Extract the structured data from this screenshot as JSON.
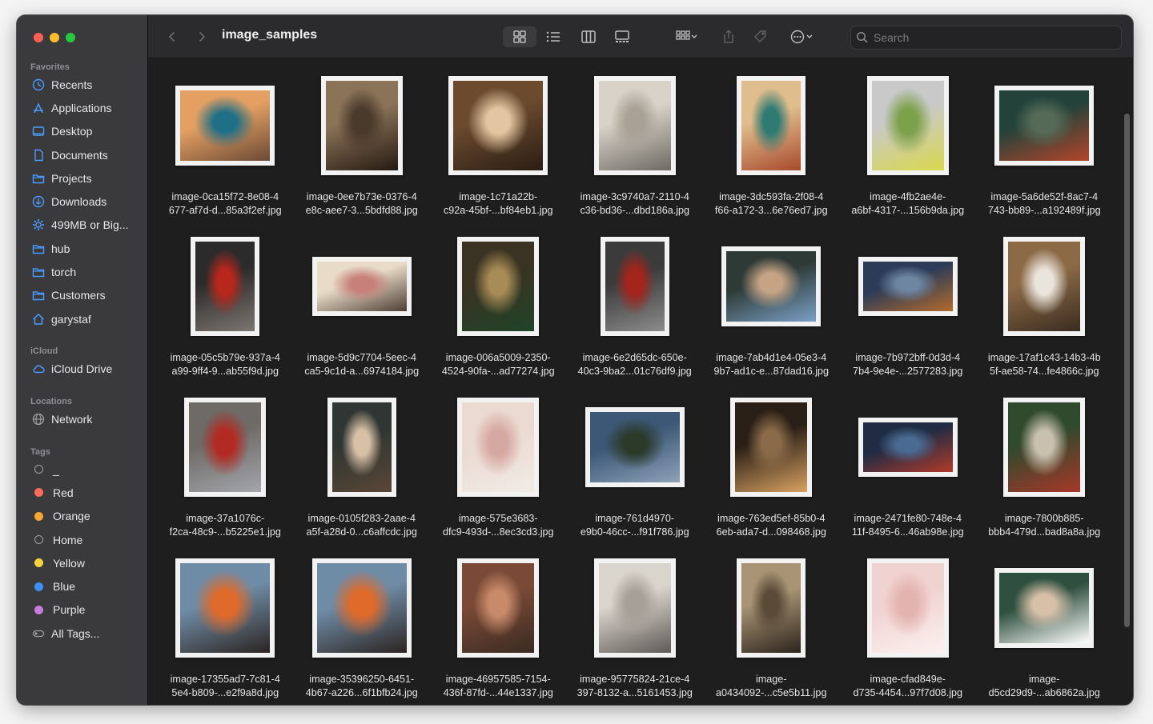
{
  "window": {
    "title": "image_samples"
  },
  "sidebar": {
    "sections": [
      {
        "heading": "Favorites",
        "items": [
          {
            "label": "Recents",
            "icon": "clock-icon"
          },
          {
            "label": "Applications",
            "icon": "applications-icon"
          },
          {
            "label": "Desktop",
            "icon": "desktop-icon"
          },
          {
            "label": "Documents",
            "icon": "document-icon"
          },
          {
            "label": "Projects",
            "icon": "folder-icon"
          },
          {
            "label": "Downloads",
            "icon": "download-icon"
          },
          {
            "label": "499MB or Big...",
            "icon": "smart-folder-icon"
          },
          {
            "label": "hub",
            "icon": "folder-icon"
          },
          {
            "label": "torch",
            "icon": "folder-icon"
          },
          {
            "label": "Customers",
            "icon": "folder-icon"
          },
          {
            "label": "garystaf",
            "icon": "home-icon"
          }
        ]
      },
      {
        "heading": "iCloud",
        "items": [
          {
            "label": "iCloud Drive",
            "icon": "cloud-icon"
          }
        ]
      },
      {
        "heading": "Locations",
        "items": [
          {
            "label": "Network",
            "icon": "network-icon"
          }
        ]
      },
      {
        "heading": "Tags",
        "items": [
          {
            "label": "_",
            "color": ""
          },
          {
            "label": "Red",
            "color": "#ff6b5b"
          },
          {
            "label": "Orange",
            "color": "#f7a533"
          },
          {
            "label": "Home",
            "color": ""
          },
          {
            "label": "Yellow",
            "color": "#f5d33a"
          },
          {
            "label": "Blue",
            "color": "#3d8ff7"
          },
          {
            "label": "Purple",
            "color": "#c77ddb"
          },
          {
            "label": "All Tags...",
            "icon": "all-tags-icon"
          }
        ]
      }
    ]
  },
  "toolbar": {
    "search_placeholder": "Search",
    "view_modes": [
      "icon-view",
      "list-view",
      "column-view",
      "gallery-view"
    ],
    "active_view": "icon-view"
  },
  "files": [
    {
      "line1": "image-0ca15f72-8e08-4",
      "line2": "677-af7d-d...85a3f2ef.jpg",
      "orientation": "landscape",
      "colors": [
        "#e4a062",
        "#1f6f86",
        "#6b4a36"
      ]
    },
    {
      "line1": "image-0ee7b73e-0376-4",
      "line2": "e8c-aee7-3...5bdfd88.jpg",
      "orientation": "square",
      "colors": [
        "#8b7358",
        "#4a3a2b",
        "#251a12"
      ]
    },
    {
      "line1": "image-1c71a22b-",
      "line2": "c92a-45bf-...bf84eb1.jpg",
      "orientation": "landscape-tall",
      "colors": [
        "#6b4a2e",
        "#e3c6a1",
        "#2a1d14"
      ]
    },
    {
      "line1": "image-3c9740a7-2110-4",
      "line2": "c36-bd36-...dbd186a.jpg",
      "orientation": "square",
      "colors": [
        "#d8d2c8",
        "#a9a196",
        "#6e6a63"
      ]
    },
    {
      "line1": "image-3dc593fa-2f08-4",
      "line2": "f66-a172-3...6e76ed7.jpg",
      "orientation": "portrait",
      "colors": [
        "#e0bd8c",
        "#2f7a73",
        "#a84a2d"
      ]
    },
    {
      "line1": "image-4fb2ae4e-",
      "line2": "a6bf-4317-...156b9da.jpg",
      "orientation": "square",
      "colors": [
        "#c9c9c9",
        "#7ca14b",
        "#d8d84c"
      ]
    },
    {
      "line1": "image-5a6de52f-8ac7-4",
      "line2": "743-bb89-...a192489f.jpg",
      "orientation": "landscape",
      "colors": [
        "#22423a",
        "#566b57",
        "#b4452a"
      ]
    },
    {
      "line1": "image-05c5b79e-937a-4",
      "line2": "a99-9ff4-9...ab55f9d.jpg",
      "orientation": "portrait",
      "colors": [
        "#2b2b2b",
        "#b8271c",
        "#7d7670"
      ]
    },
    {
      "line1": "image-5d9c7704-5eec-4",
      "line2": "ca5-9c1d-a...6974184.jpg",
      "orientation": "landscape-wide",
      "colors": [
        "#e8dcc6",
        "#c7807a",
        "#4d3d35"
      ]
    },
    {
      "line1": "image-006a5009-2350-",
      "line2": "4524-90fa-...ad77274.jpg",
      "orientation": "square",
      "colors": [
        "#3a3222",
        "#a88c55",
        "#204428"
      ]
    },
    {
      "line1": "image-6e2d65dc-650e-",
      "line2": "40c3-9ba2...01c76df9.jpg",
      "orientation": "portrait",
      "colors": [
        "#3b3b3b",
        "#a3251c",
        "#8c8c8c"
      ]
    },
    {
      "line1": "image-7ab4d1e4-05e3-4",
      "line2": "9b7-ad1c-e...87dad16.jpg",
      "orientation": "landscape",
      "colors": [
        "#2d3a36",
        "#c6a385",
        "#7aa0c6"
      ]
    },
    {
      "line1": "image-7b972bff-0d3d-4",
      "line2": "7b4-9e4e-...2577283.jpg",
      "orientation": "landscape-wide",
      "colors": [
        "#2c3c58",
        "#6e86a2",
        "#b36a2c"
      ]
    },
    {
      "line1": "image-17af1c43-14b3-4b",
      "line2": "5f-ae58-74...fe4866c.jpg",
      "orientation": "square",
      "colors": [
        "#8c6a46",
        "#e9e4dc",
        "#3a2c20"
      ]
    },
    {
      "line1": "image-37a1076c-",
      "line2": "f2ca-48c9-...b5225e1.jpg",
      "orientation": "square-narrow",
      "colors": [
        "#6e6a66",
        "#b22a22",
        "#a4a6ac"
      ]
    },
    {
      "line1": "image-0105f283-2aae-4",
      "line2": "a5f-a28d-0...c6affcdc.jpg",
      "orientation": "portrait",
      "colors": [
        "#2f3633",
        "#d7c0a6",
        "#5a4636"
      ]
    },
    {
      "line1": "image-575e3683-",
      "line2": "dfc9-493d-...8ec3cd3.jpg",
      "orientation": "square",
      "colors": [
        "#eadad0",
        "#d6a8a2",
        "#f1ebe6"
      ]
    },
    {
      "line1": "image-761d4970-",
      "line2": "e9b0-46cc-...f91f786.jpg",
      "orientation": "landscape",
      "colors": [
        "#3c5876",
        "#2c3a2a",
        "#8ea2b8"
      ]
    },
    {
      "line1": "image-763ed5ef-85b0-4",
      "line2": "6eb-ada7-d...098468.jpg",
      "orientation": "square",
      "colors": [
        "#2a1f16",
        "#8a6a48",
        "#d9a262"
      ]
    },
    {
      "line1": "image-2471fe80-748e-4",
      "line2": "11f-8495-6...46ab98e.jpg",
      "orientation": "landscape-wide",
      "colors": [
        "#1f2c44",
        "#4a6a92",
        "#b23a2a"
      ]
    },
    {
      "line1": "image-7800b885-",
      "line2": "bbb4-479d...bad8a8a.jpg",
      "orientation": "square",
      "colors": [
        "#2f4a2c",
        "#c9c0ad",
        "#a8372a"
      ]
    },
    {
      "line1": "image-17355ad7-7c81-4",
      "line2": "5e4-b809-...e2f9a8d.jpg",
      "orientation": "landscape-tall",
      "colors": [
        "#6f8ca6",
        "#e06a2a",
        "#2c2421"
      ]
    },
    {
      "line1": "image-35396250-6451-",
      "line2": "4b67-a226...6f1bfb24.jpg",
      "orientation": "landscape-tall",
      "colors": [
        "#6f8ca6",
        "#e06a2a",
        "#2c2421"
      ]
    },
    {
      "line1": "image-46957585-7154-",
      "line2": "436f-87fd-...44e1337.jpg",
      "orientation": "square",
      "colors": [
        "#7a4a36",
        "#c98a6a",
        "#3a2a22"
      ]
    },
    {
      "line1": "image-95775824-21ce-4",
      "line2": "397-8132-a...5161453.jpg",
      "orientation": "square",
      "colors": [
        "#d9d4cc",
        "#a7a098",
        "#5f5a55"
      ]
    },
    {
      "line1": "image-",
      "line2": "a0434092-...c5e5b11.jpg",
      "orientation": "portrait",
      "colors": [
        "#a89474",
        "#5a4a38",
        "#2b231b"
      ]
    },
    {
      "line1": "image-cfad849e-",
      "line2": "d735-4454...97f7d08.jpg",
      "orientation": "square",
      "colors": [
        "#f0d2d0",
        "#e3b3b0",
        "#fbf1ef"
      ]
    },
    {
      "line1": "image-",
      "line2": "d5cd29d9-...ab6862a.jpg",
      "orientation": "landscape",
      "colors": [
        "#2f5040",
        "#d8c0a8",
        "#ffffff"
      ]
    }
  ]
}
